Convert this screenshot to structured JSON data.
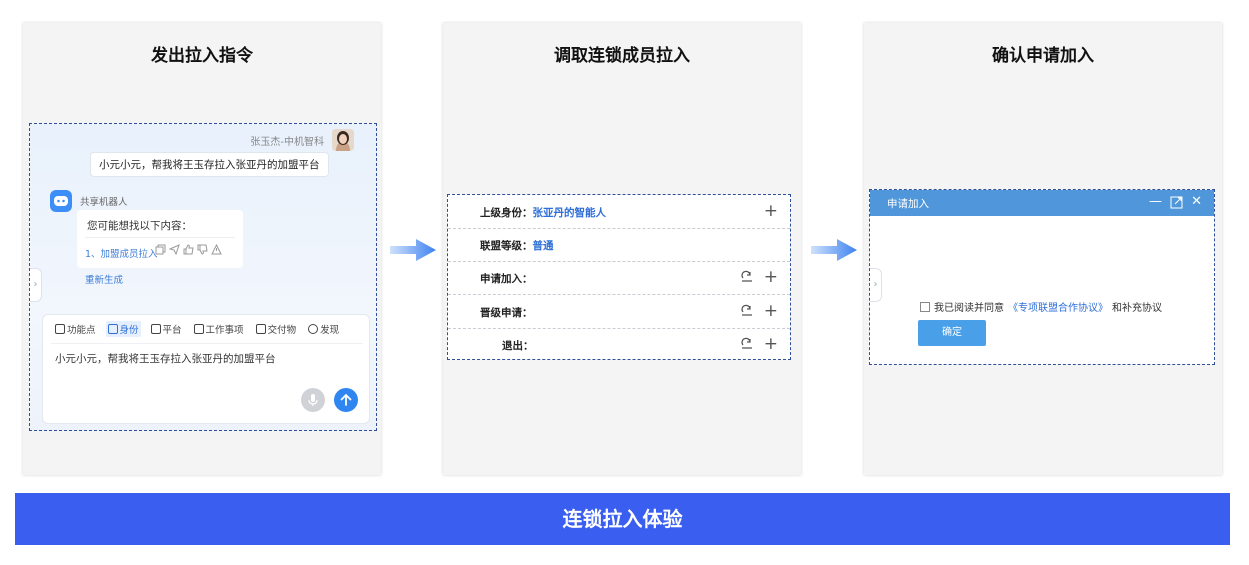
{
  "panels": {
    "issue": {
      "title": "发出拉入指令"
    },
    "select": {
      "title": "调取连锁成员拉入"
    },
    "confirm": {
      "title": "确认申请加入"
    }
  },
  "chat": {
    "user_name": "张玉杰-中机智科",
    "user_message": "小元小元，帮我将王玉存拉入张亚丹的加盟平台",
    "bot_name": "共享机器人",
    "bot_reply_title": "您可能想找以下内容：",
    "bot_reply_link": "1、加盟成员拉入",
    "regenerate": "重新生成",
    "toolbar": [
      "功能点",
      "身份",
      "平台",
      "工作事项",
      "交付物",
      "发现"
    ],
    "active_tool": "身份",
    "input_value": "小元小元，帮我将王玉存拉入张亚丹的加盟平台"
  },
  "member_list": {
    "rows": [
      {
        "label": "上级身份：",
        "value": "张亚丹的智能人"
      },
      {
        "label": "联盟等级：",
        "value": "普通"
      },
      {
        "label": "申请加入：",
        "value": ""
      },
      {
        "label": "晋级申请：",
        "value": ""
      },
      {
        "label": "退出：",
        "value": ""
      }
    ]
  },
  "dialog": {
    "title": "申请加入",
    "agree_prefix": "我已阅读并同意",
    "agree_link": "《专项联盟合作协议》",
    "agree_suffix": "和补充协议",
    "confirm_button": "确定"
  },
  "banner": "连锁拉入体验",
  "colors": {
    "banner": "#3a5ef0",
    "accent": "#2f6fd8",
    "dialog_header": "#4f97da",
    "arrow": "#3d82f0"
  }
}
